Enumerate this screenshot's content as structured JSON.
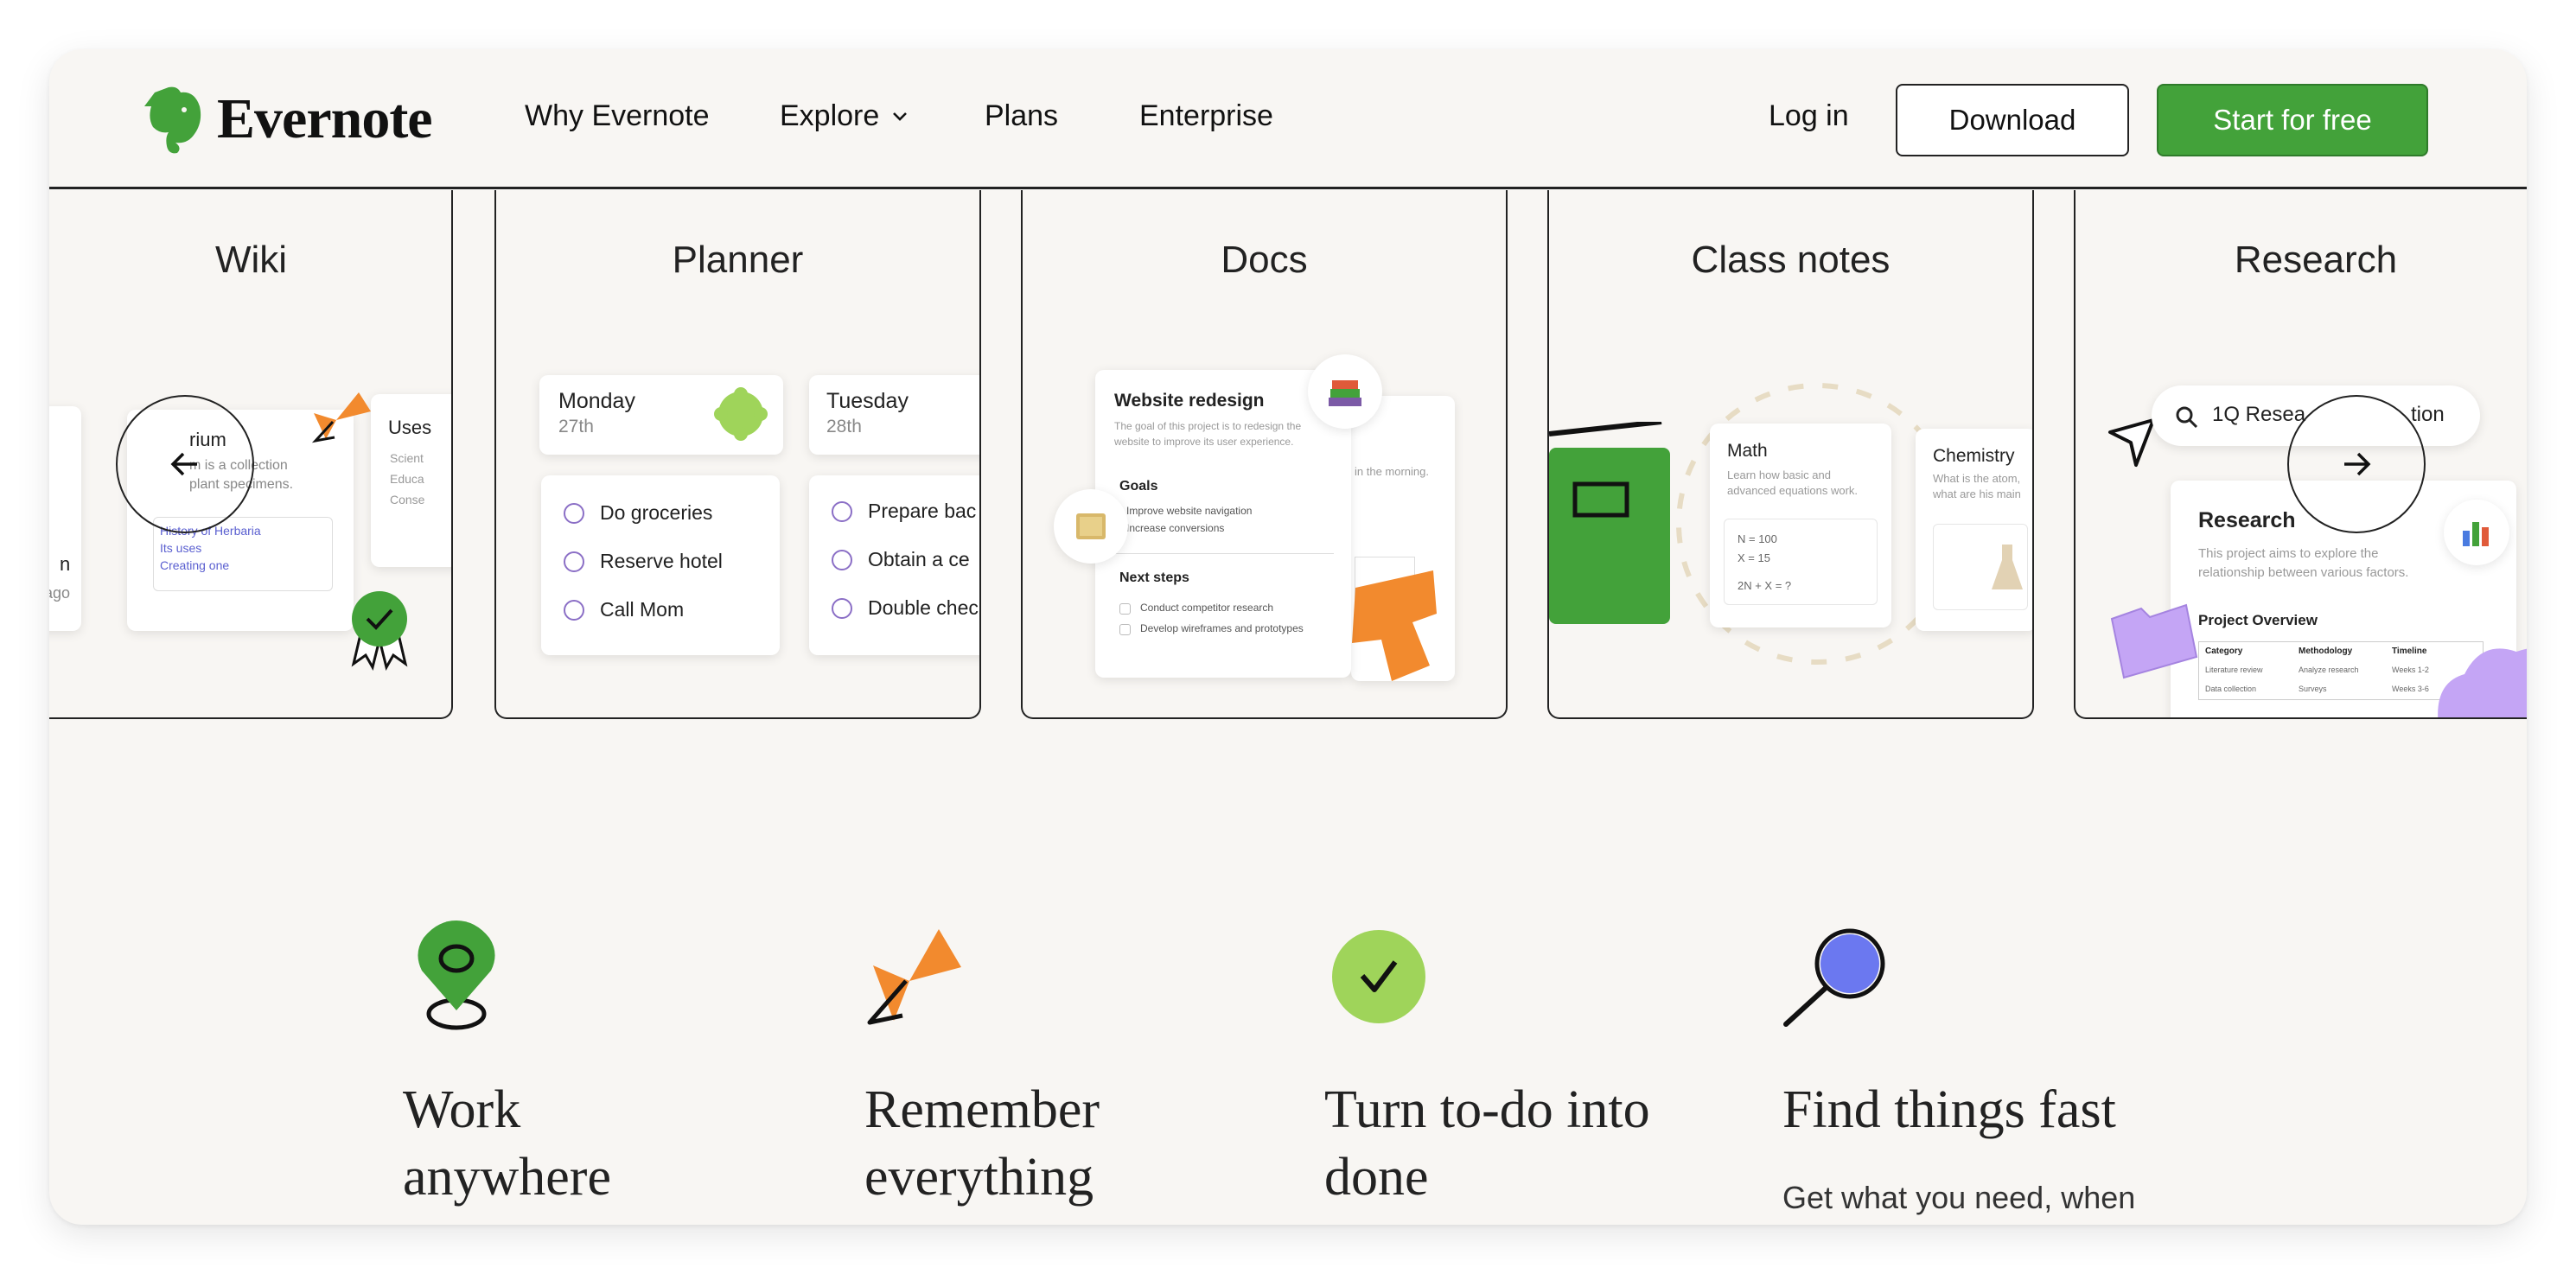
{
  "brand": {
    "name": "Evernote"
  },
  "nav": {
    "links": [
      "Why Evernote",
      "Explore",
      "Plans",
      "Enterprise"
    ],
    "login": "Log in",
    "download": "Download",
    "start": "Start for free"
  },
  "cards": [
    {
      "title": "Wiki",
      "frag_left": [
        "n",
        "ago"
      ],
      "mini_title": "rium",
      "mini_text": [
        "m is a collection",
        "plant specimens."
      ],
      "links": [
        "History of Herbaria",
        "Its uses",
        "Creating one"
      ],
      "uses_title": "Uses",
      "uses_items": [
        "Scient",
        "Educa",
        "Conse"
      ]
    },
    {
      "title": "Planner",
      "days": [
        {
          "name": "Monday",
          "date": "27th"
        },
        {
          "name": "Tuesday",
          "date": "28th"
        }
      ],
      "todos_1": [
        "Do groceries",
        "Reserve hotel",
        "Call Mom"
      ],
      "todos_2": [
        "Prepare bac",
        "Obtain a ce",
        "Double chec"
      ]
    },
    {
      "title": "Docs",
      "doc_title": "Website redesign",
      "doc_desc": [
        "The goal of this project is to redesign the",
        "website to improve its user experience."
      ],
      "goals_title": "Goals",
      "goals": [
        "Improve website navigation",
        "Increase conversions"
      ],
      "next_title": "Next steps",
      "next_items": [
        "Conduct competitor research",
        "Develop wireframes and prototypes"
      ],
      "behind_text": "in the morning."
    },
    {
      "title": "Class notes",
      "math_title": "Math",
      "math_desc": [
        "Learn how basic and",
        "advanced equations work."
      ],
      "equations": [
        "N = 100",
        "X = 15",
        "2N + X = ?"
      ],
      "chem_title": "Chemistry",
      "chem_desc": [
        "What is the atom,",
        "what are his main"
      ]
    },
    {
      "title": "Research",
      "search_value": "1Q Resea",
      "search_tail": "tion",
      "doc_title": "Research",
      "doc_desc": [
        "This project aims to explore the",
        "relationship between various factors."
      ],
      "overview": "Project Overview",
      "table_headers": [
        "Category",
        "Methodology",
        "Timeline"
      ],
      "table_rows": [
        [
          "Literature review",
          "Analyze research",
          "Weeks 1-2"
        ],
        [
          "Data collection",
          "Surveys",
          "Weeks 3-6"
        ]
      ]
    }
  ],
  "features": [
    {
      "title_l1": "Work",
      "title_l2": "anywhere",
      "desc": ""
    },
    {
      "title_l1": "Remember",
      "title_l2": "everything",
      "desc": ""
    },
    {
      "title_l1": "Turn to-do into",
      "title_l2": "done",
      "desc": ""
    },
    {
      "title_l1": "Find things fast",
      "title_l2": "",
      "desc": "Get what you need, when"
    }
  ],
  "colors": {
    "green": "#43a23a",
    "orange": "#f28a2e",
    "lime": "#9fd45a",
    "purple": "#c4a5f5",
    "blue": "#6b78f0"
  },
  "icons": [
    "left-arrow-icon",
    "right-arrow-icon",
    "chevron-down-icon",
    "elephant-logo-icon",
    "search-icon",
    "pin-icon",
    "bow-icon",
    "check-icon",
    "magnifier-icon"
  ]
}
